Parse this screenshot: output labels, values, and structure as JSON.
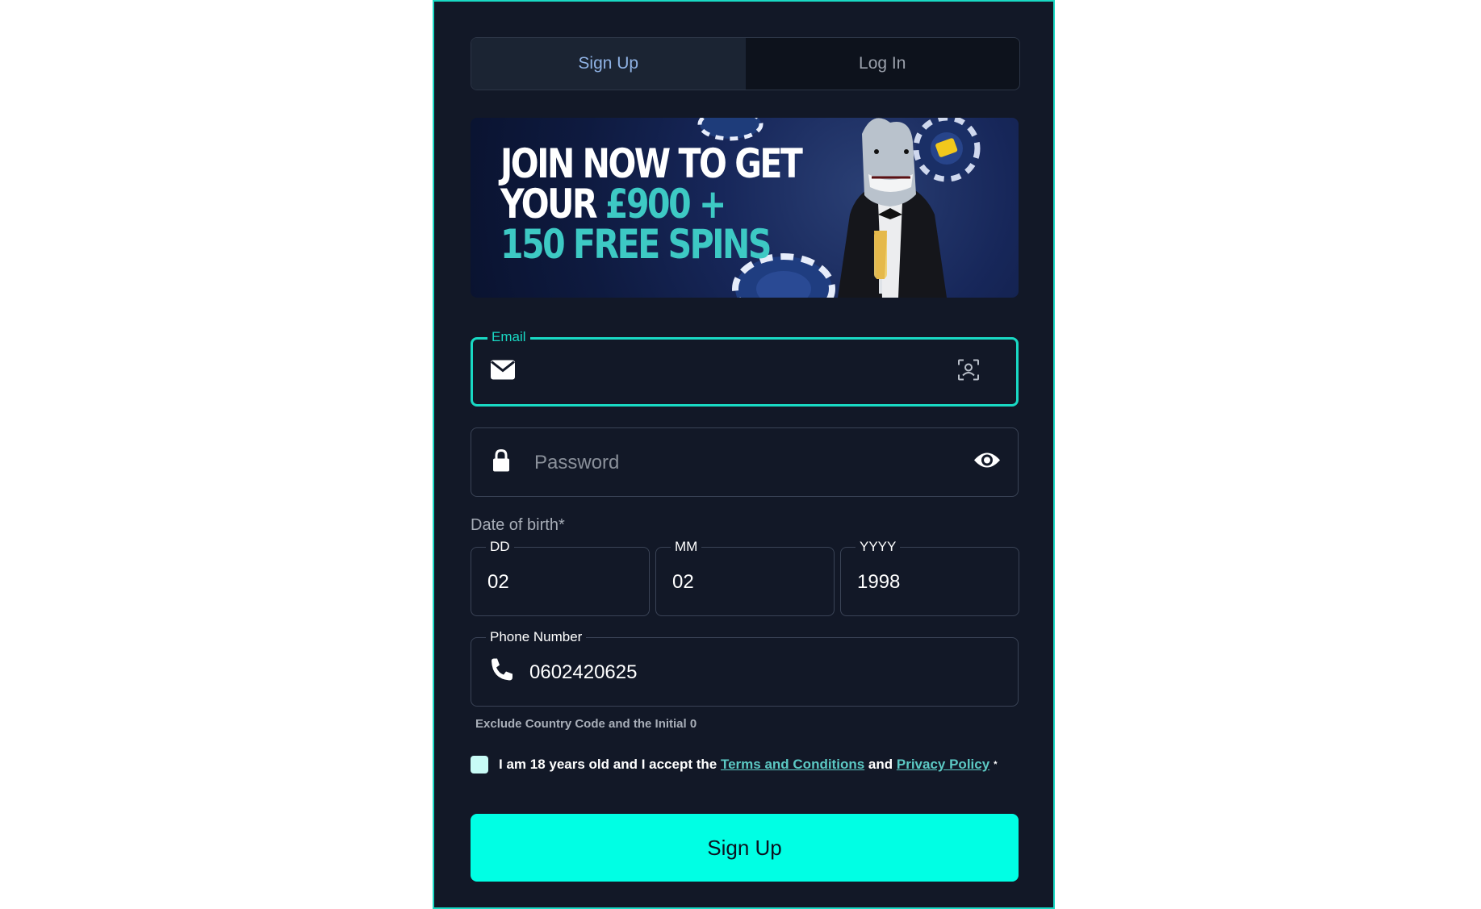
{
  "tabs": [
    {
      "label": "Sign Up",
      "active": true
    },
    {
      "label": "Log In",
      "active": false
    }
  ],
  "banner": {
    "line1": "JOIN NOW TO GET",
    "line2_prefix": "YOUR ",
    "line2_amount": "£900 +",
    "line3": "150 FREE SPINS"
  },
  "email": {
    "label": "Email",
    "value": "",
    "icon": "envelope-icon",
    "action_icon": "face-scan-icon"
  },
  "password": {
    "placeholder": "Password",
    "icon": "lock-icon",
    "action_icon": "eye-icon"
  },
  "dob": {
    "title": "Date of birth*",
    "fields": [
      {
        "label": "DD",
        "value": "02"
      },
      {
        "label": "MM",
        "value": "02"
      },
      {
        "label": "YYYY",
        "value": "1998"
      }
    ]
  },
  "phone": {
    "label": "Phone Number",
    "value": "0602420625",
    "icon": "phone-icon",
    "hint": "Exclude Country Code and the Initial 0"
  },
  "consent": {
    "text": "I am 18 years old and I accept the",
    "terms_link": "Terms and Conditions",
    "and": "and",
    "privacy_link": "Privacy Policy",
    "required_mark": "*"
  },
  "submit_label": "Sign Up",
  "colors": {
    "accent": "#19d9c4",
    "button": "#00ffe4",
    "background": "#121827"
  }
}
